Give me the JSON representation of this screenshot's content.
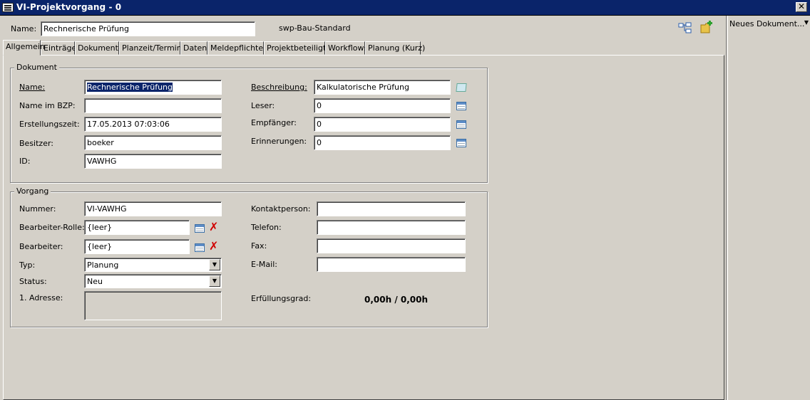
{
  "window": {
    "title": "VI-Projektvorgang - 0",
    "close_label": "✕"
  },
  "header": {
    "name_label": "Name:",
    "name_value": "Rechnerische Prüfung",
    "template": "swp-Bau-Standard"
  },
  "tabs": [
    {
      "label": "Allgemein",
      "active": true
    },
    {
      "label": "Einträge"
    },
    {
      "label": "Dokumente"
    },
    {
      "label": "Planzeit/Termine"
    },
    {
      "label": "Daten"
    },
    {
      "label": "Meldepflichten"
    },
    {
      "label": "Projektbeteiligte"
    },
    {
      "label": "Workflows"
    },
    {
      "label": "Planung (Kurz)"
    }
  ],
  "dokument": {
    "title": "Dokument",
    "name_label": "Name:",
    "name_value": "Rechnerische Prüfung",
    "bzp_label": "Name im BZP:",
    "bzp_value": "",
    "created_label": "Erstellungszeit:",
    "created_value": "17.05.2013 07:03:06",
    "owner_label": "Besitzer:",
    "owner_value": "boeker",
    "id_label": "ID:",
    "id_value": "VAWHG",
    "desc_label": "Beschreibung:",
    "desc_value": "Kalkulatorische Prüfung",
    "reader_label": "Leser:",
    "reader_value": "0",
    "recipient_label": "Empfänger:",
    "recipient_value": "0",
    "reminder_label": "Erinnerungen:",
    "reminder_value": "0"
  },
  "vorgang": {
    "title": "Vorgang",
    "number_label": "Nummer:",
    "number_value": "VI-VAWHG",
    "role_label": "Bearbeiter-Rolle:",
    "role_value": "{leer}",
    "editor_label": "Bearbeiter:",
    "editor_value": "{leer}",
    "type_label": "Typ:",
    "type_value": "Planung",
    "status_label": "Status:",
    "status_value": "Neu",
    "address_label": "1. Adresse:",
    "contact_label": "Kontaktperson:",
    "contact_value": "",
    "phone_label": "Telefon:",
    "phone_value": "",
    "fax_label": "Fax:",
    "fax_value": "",
    "email_label": "E-Mail:",
    "email_value": "",
    "fulfillment_label": "Erfüllungsgrad:",
    "fulfillment_value": "0,00h / 0,00h"
  },
  "sidepanel": {
    "new_doc_label": "Neues Dokument..."
  }
}
